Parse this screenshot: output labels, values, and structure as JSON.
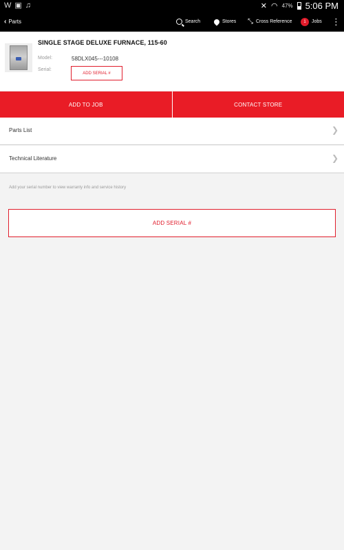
{
  "status_bar": {
    "left_icons": [
      "W",
      "▣",
      "♫"
    ],
    "battery_percent": "47%",
    "time": "5:06 PM"
  },
  "app_bar": {
    "back_label": "Parts",
    "nav": {
      "search_label": "Search",
      "stores_label": "Stores",
      "cross_reference_label": "Cross Reference",
      "jobs_label": "Jobs",
      "jobs_count": "1",
      "more_label": "⋮"
    }
  },
  "product": {
    "title": "SINGLE STAGE DELUXE FURNACE, 115-60",
    "model_label": "Model:",
    "model_value": "58DLX045---10108",
    "serial_label": "Serial:",
    "add_serial_label": "ADD SERIAL #"
  },
  "actions": {
    "add_to_job": "ADD TO JOB",
    "contact_store": "CONTACT STORE"
  },
  "list": [
    {
      "label": "Parts List",
      "chevron": "❯"
    },
    {
      "label": "Technical Literature",
      "chevron": "❯"
    }
  ],
  "hint_text": "Add your serial number to view warranty info and service history",
  "add_serial_big_label": "ADD SERIAL #",
  "colors": {
    "accent_red": "#e91c26",
    "bar_black": "#000000",
    "background": "#f3f3f3"
  }
}
